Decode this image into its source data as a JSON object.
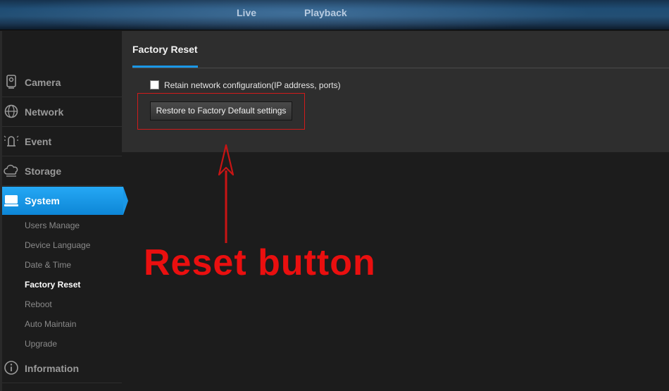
{
  "topnav": {
    "live": "Live",
    "playback": "Playback"
  },
  "sidebar": {
    "items": [
      {
        "label": "Camera",
        "icon": "camera-icon"
      },
      {
        "label": "Network",
        "icon": "network-globe-icon"
      },
      {
        "label": "Event",
        "icon": "event-alarm-icon"
      },
      {
        "label": "Storage",
        "icon": "storage-cloud-icon"
      },
      {
        "label": "System",
        "icon": "system-monitor-icon",
        "active": true
      },
      {
        "label": "Information",
        "icon": "info-icon"
      }
    ],
    "system_subitems": [
      {
        "label": "Users Manage"
      },
      {
        "label": "Device Language"
      },
      {
        "label": "Date & Time"
      },
      {
        "label": "Factory Reset",
        "active": true
      },
      {
        "label": "Reboot"
      },
      {
        "label": "Auto Maintain"
      },
      {
        "label": "Upgrade"
      }
    ]
  },
  "main": {
    "tab_title": "Factory Reset",
    "retain_label": "Retain network configuration(IP address, ports)",
    "retain_checked": false,
    "reset_button": "Restore to Factory Default settings"
  },
  "annotation": {
    "text": "Reset button",
    "color": "#ea0f0f"
  },
  "colors": {
    "accent": "#1a97e6",
    "highlight_border": "#d11b1b"
  }
}
